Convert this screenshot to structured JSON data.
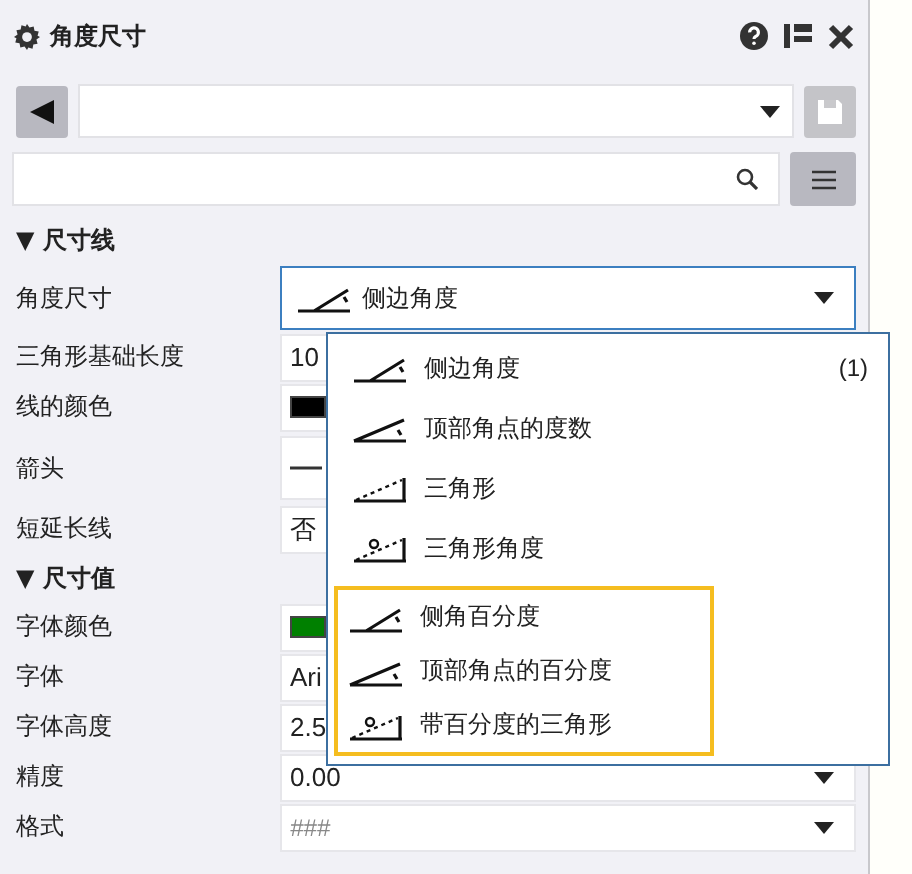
{
  "panel": {
    "title": "角度尺寸"
  },
  "sections": [
    {
      "toggle": "▼",
      "title": "尺寸线",
      "expanded": true,
      "rows": [
        {
          "label": "角度尺寸",
          "kind": "angle-combo",
          "value": "侧边角度",
          "focused": true
        },
        {
          "label": "三角形基础长度",
          "kind": "text",
          "value": "10",
          "focused": false
        },
        {
          "label": "线的颜色",
          "kind": "color",
          "color": "#000000",
          "focused": false
        },
        {
          "label": "箭头",
          "kind": "arrow",
          "focused": false
        },
        {
          "label": "短延长线",
          "kind": "text",
          "value": "否",
          "focused": false
        }
      ]
    },
    {
      "toggle": "▼",
      "title": "尺寸值",
      "expanded": true,
      "rows": [
        {
          "label": "字体颜色",
          "kind": "color",
          "color": "#008000",
          "focused": false
        },
        {
          "label": "字体",
          "kind": "text",
          "value": "Ari",
          "focused": false
        },
        {
          "label": "字体高度",
          "kind": "text",
          "value": "2.5",
          "focused": false
        },
        {
          "label": "精度",
          "kind": "combo",
          "value": "0.00",
          "focused": false
        },
        {
          "label": "格式",
          "kind": "combo",
          "placeholder": "###",
          "focused": false
        }
      ]
    }
  ],
  "dropdown": {
    "groups": [
      {
        "highlighted": false,
        "items": [
          {
            "label": "侧边角度",
            "kind": "side-angle",
            "count": "(1)"
          },
          {
            "label": "顶部角点的度数",
            "kind": "top-angle"
          },
          {
            "label": "三角形",
            "kind": "triangle"
          },
          {
            "label": "三角形角度",
            "kind": "triangle-angle"
          }
        ]
      },
      {
        "highlighted": true,
        "items": [
          {
            "label": "侧角百分度",
            "kind": "side-angle"
          },
          {
            "label": "顶部角点的百分度",
            "kind": "top-angle"
          },
          {
            "label": "带百分度的三角形",
            "kind": "triangle-angle"
          }
        ]
      }
    ]
  }
}
